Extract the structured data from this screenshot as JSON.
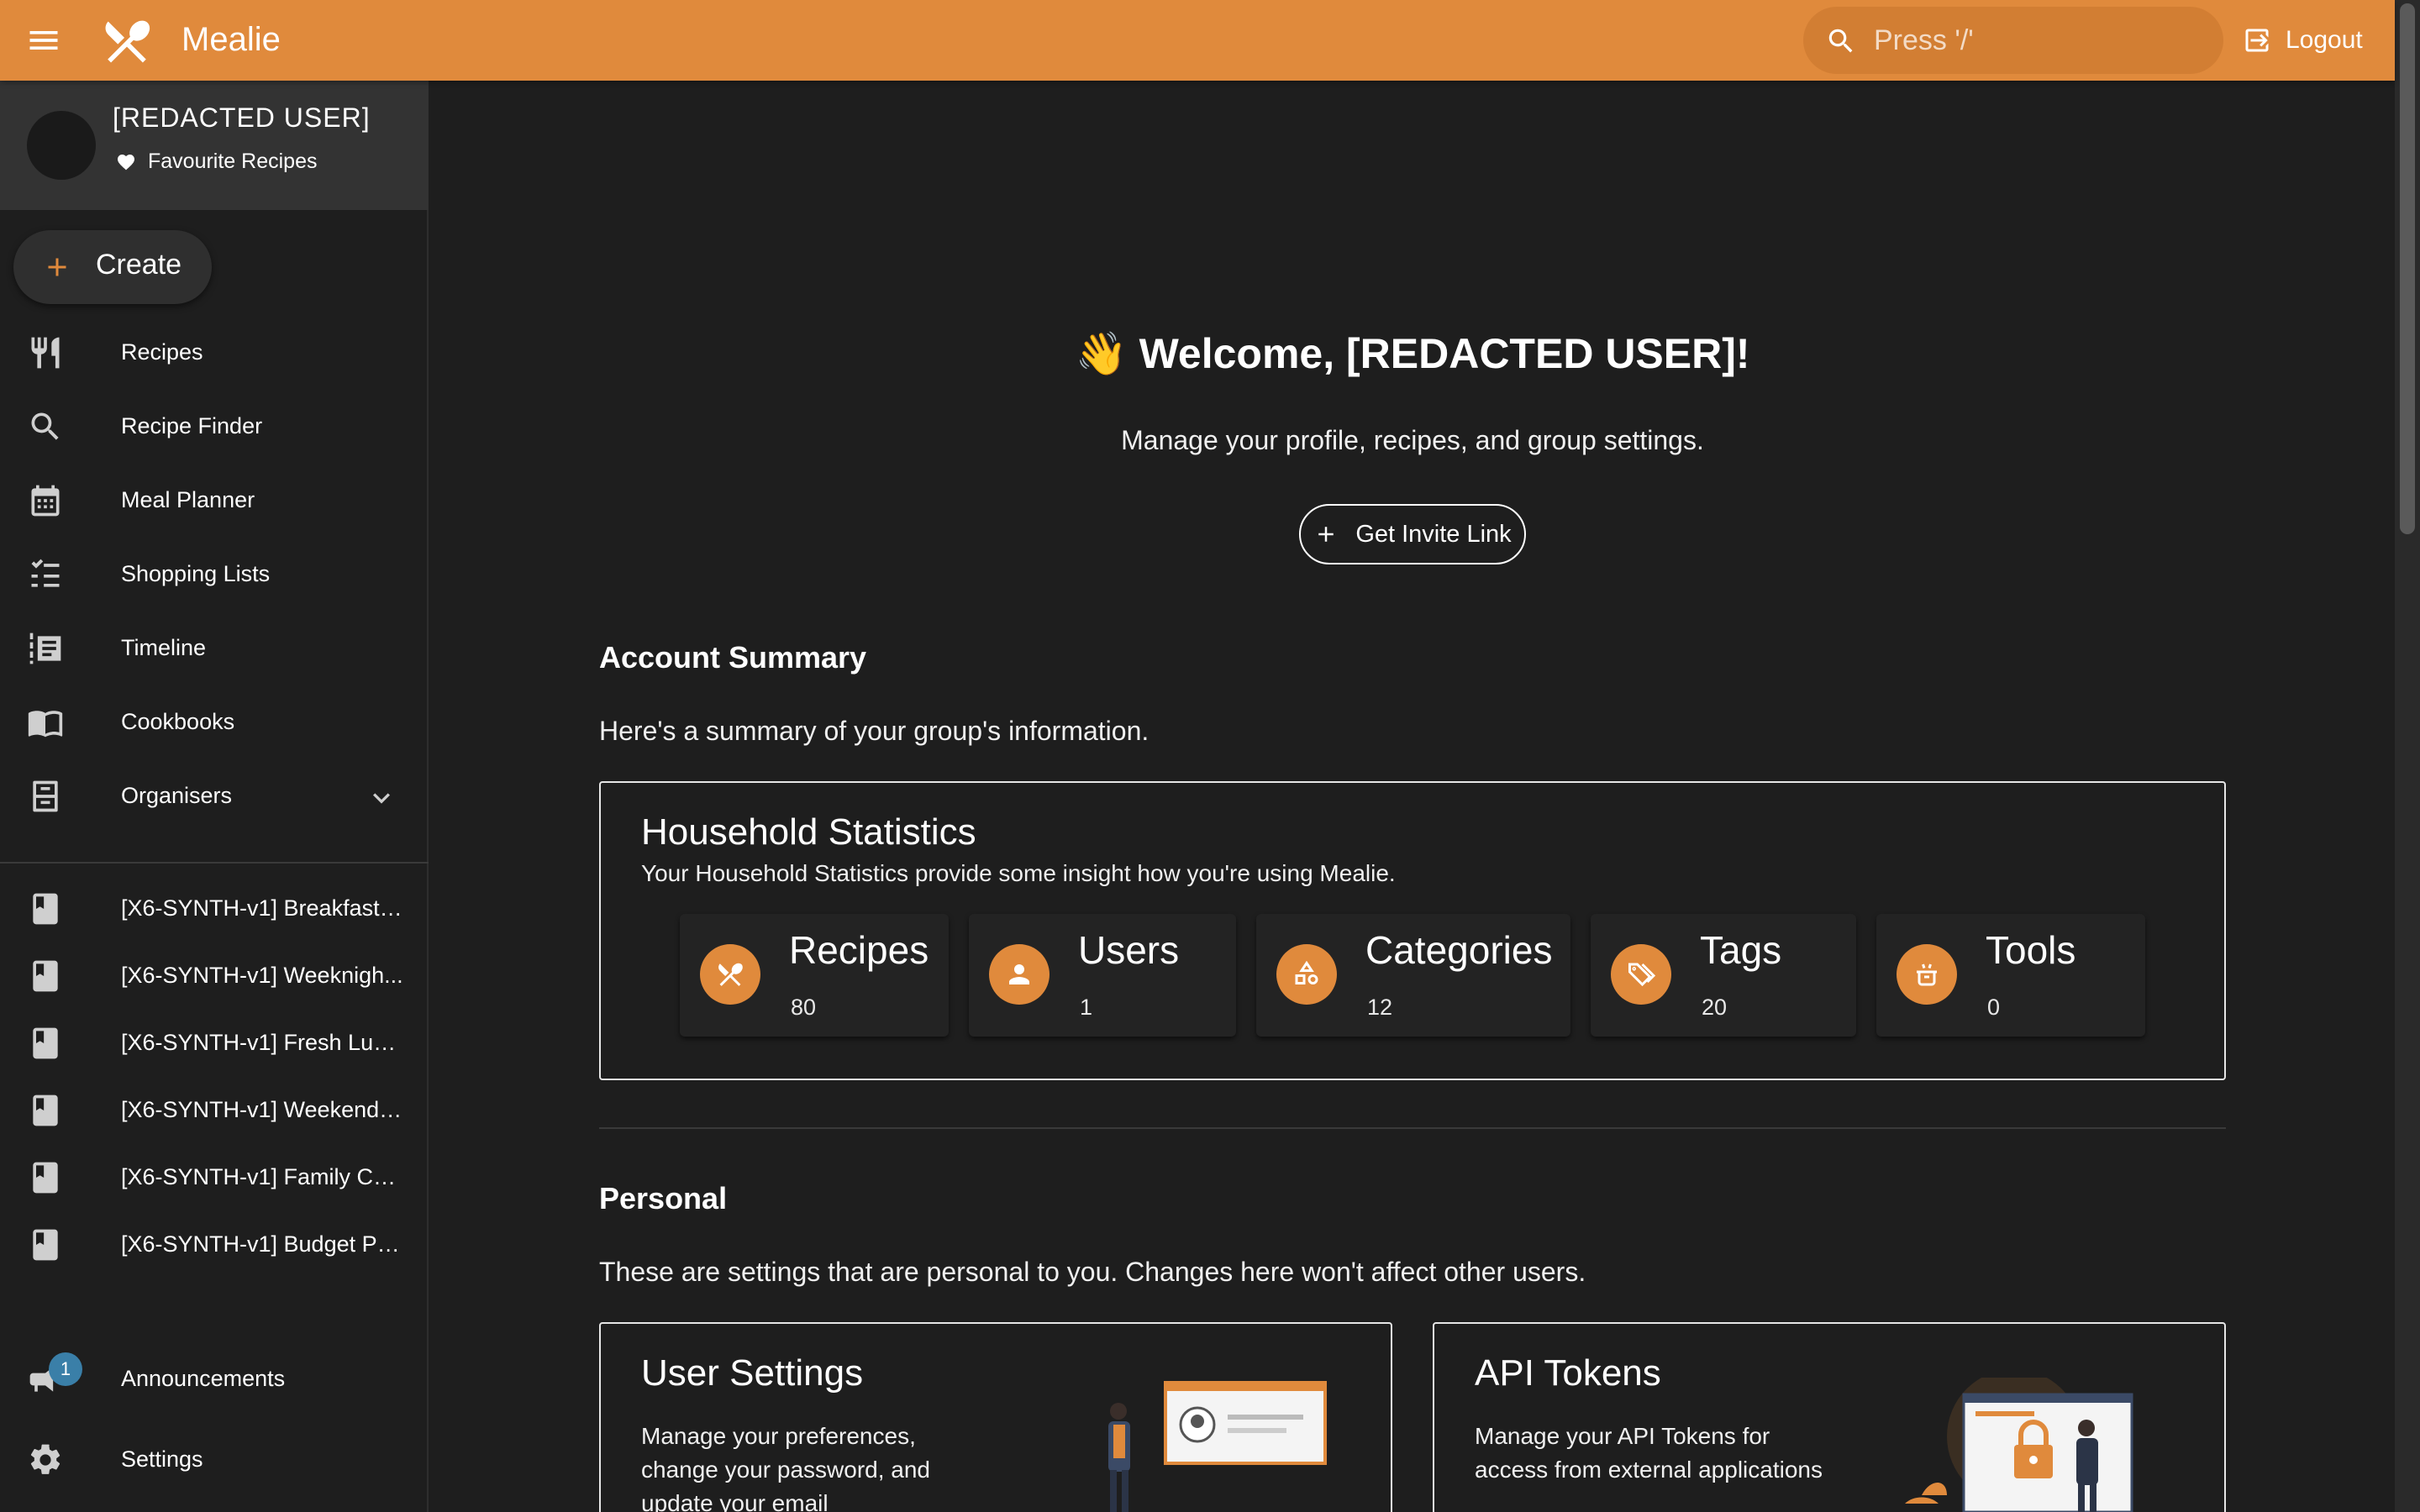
{
  "header": {
    "app_title": "Mealie",
    "search_placeholder": "Press '/'",
    "logout_label": "Logout",
    "accent": "#e08a3c"
  },
  "sidebar": {
    "user_name": "[REDACTED USER]",
    "favourites_label": "Favourite Recipes",
    "create_label": "Create",
    "nav": [
      {
        "label": "Recipes",
        "icon": "fork-knife-icon"
      },
      {
        "label": "Recipe Finder",
        "icon": "search-icon"
      },
      {
        "label": "Meal Planner",
        "icon": "calendar-icon"
      },
      {
        "label": "Shopping Lists",
        "icon": "checklist-icon"
      },
      {
        "label": "Timeline",
        "icon": "timeline-icon"
      },
      {
        "label": "Cookbooks",
        "icon": "book-open-icon"
      },
      {
        "label": "Organisers",
        "icon": "file-cabinet-icon"
      }
    ],
    "cookbooks": [
      "[X6-SYNTH-v1] Breakfast ...",
      "[X6-SYNTH-v1] Weeknigh...",
      "[X6-SYNTH-v1] Fresh Lun...",
      "[X6-SYNTH-v1] Weekend ...",
      "[X6-SYNTH-v1] Family Co...",
      "[X6-SYNTH-v1] Budget Pa..."
    ],
    "announcements_label": "Announcements",
    "announcements_badge": "1",
    "settings_label": "Settings"
  },
  "main": {
    "welcome_emoji": "👋",
    "welcome_text": "Welcome, [REDACTED USER]!",
    "subtitle": "Manage your profile, recipes, and group settings.",
    "invite_label": "Get Invite Link",
    "account_summary": {
      "title": "Account Summary",
      "desc": "Here's a summary of your group's information."
    },
    "household": {
      "title": "Household Statistics",
      "desc": "Your Household Statistics provide some insight how you're using Mealie.",
      "stats": [
        {
          "name": "Recipes",
          "count": "80",
          "icon": "fork-knife-icon"
        },
        {
          "name": "Users",
          "count": "1",
          "icon": "user-icon"
        },
        {
          "name": "Categories",
          "count": "12",
          "icon": "shapes-icon"
        },
        {
          "name": "Tags",
          "count": "20",
          "icon": "tags-icon"
        },
        {
          "name": "Tools",
          "count": "0",
          "icon": "pot-icon"
        }
      ]
    },
    "personal": {
      "title": "Personal",
      "desc": "These are settings that are personal to you. Changes here won't affect other users.",
      "cards": [
        {
          "title": "User Settings",
          "desc": "Manage your preferences, change your password, and update your email"
        },
        {
          "title": "API Tokens",
          "desc": "Manage your API Tokens for access from external applications"
        }
      ]
    }
  }
}
